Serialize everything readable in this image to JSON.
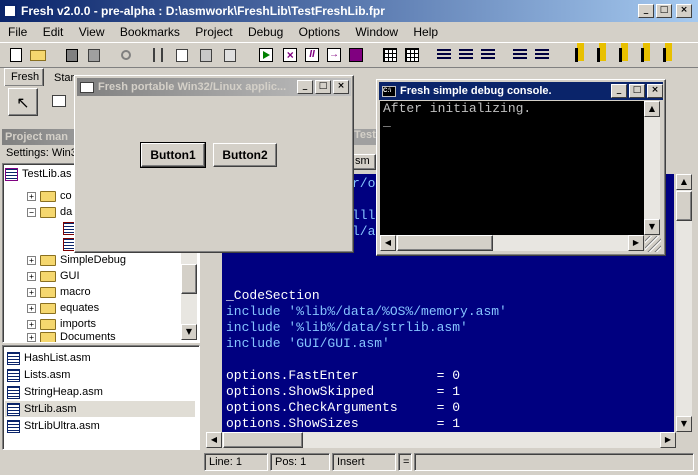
{
  "main_window": {
    "title": "Fresh v2.0.0 - pre-alpha : D:\\asmwork\\FreshLib\\TestFreshLib.fpr"
  },
  "menu": [
    "File",
    "Edit",
    "View",
    "Bookmarks",
    "Project",
    "Debug",
    "Options",
    "Window",
    "Help"
  ],
  "tabs": [
    "Fresh",
    "Star"
  ],
  "project_panel": {
    "title": "Project man",
    "settings": "Settings: Win3",
    "root": "TestLib.as",
    "tree": [
      "co",
      "da",
      "",
      "",
      "SimpleDebug",
      "GUI",
      "macro",
      "equates",
      "imports",
      "Documents"
    ]
  },
  "file_list": [
    "HashList.asm",
    "Lists.asm",
    "StringHeap.asm",
    "StrLib.asm",
    "StrLibUltra.asm"
  ],
  "editor": {
    "tab_label": "Test",
    "file_tab": "sm",
    "partial_lines": [
      "r/o",
      "",
      "lllm",
      "l/al"
    ],
    "lines": [
      {
        "text": "_CodeSection",
        "color": "#ffffff"
      },
      {
        "text": "include '%lib%/data/%OS%/memory.asm'",
        "color": "#86c4ff"
      },
      {
        "text": "include '%lib%/data/strlib.asm'",
        "color": "#86c4ff"
      },
      {
        "text": "include 'GUI/GUI.asm'",
        "color": "#86c4ff"
      },
      {
        "text": "",
        "color": "#ffffff"
      },
      {
        "text": "options.FastEnter          = 0",
        "color": "#ffffff"
      },
      {
        "text": "options.ShowSkipped        = 1",
        "color": "#ffffff"
      },
      {
        "text": "options.CheckArguments     = 0",
        "color": "#ffffff"
      },
      {
        "text": "options.ShowSizes          = 1",
        "color": "#ffffff"
      }
    ]
  },
  "gui_window": {
    "title": "Fresh portable Win32/Linux applic...",
    "button1": "Button1",
    "button2": "Button2"
  },
  "console_window": {
    "title": "Fresh simple debug console.",
    "text": "After initializing.",
    "cursor": "_"
  },
  "status": {
    "line": "Line: 1",
    "pos": "Pos: 1",
    "mode": "Insert",
    "eq": "="
  }
}
